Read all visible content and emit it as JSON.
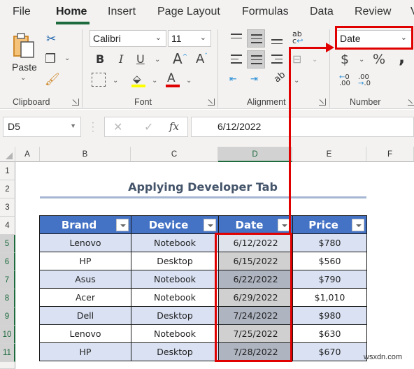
{
  "ribbon": {
    "tabs": [
      "File",
      "Home",
      "Insert",
      "Page Layout",
      "Formulas",
      "Data",
      "Review",
      "V"
    ],
    "active_tab": "Home",
    "clipboard": {
      "paste_label": "Paste",
      "group_label": "Clipboard"
    },
    "font": {
      "font_name": "Calibri",
      "font_size": "11",
      "group_label": "Font",
      "bold": "B",
      "italic": "I",
      "underline": "U",
      "grow": "A",
      "shrink": "A",
      "font_color": "A",
      "fill_color_hex": "#ffff00",
      "font_color_hex": "#e00000"
    },
    "alignment": {
      "group_label": "Alignment",
      "wrap": "ab\nc"
    },
    "number": {
      "format_value": "Date",
      "currency": "$",
      "percent": "%",
      "comma": "❜",
      "group_label": "Number"
    }
  },
  "formula_bar": {
    "name_box": "D5",
    "cancel": "✕",
    "enter": "✓",
    "fx": "fx",
    "value": "6/12/2022"
  },
  "grid": {
    "columns": [
      "A",
      "B",
      "C",
      "D",
      "E",
      "F"
    ],
    "rows": [
      "1",
      "2",
      "3",
      "4",
      "5",
      "6",
      "7",
      "8",
      "9",
      "10",
      "11"
    ],
    "selected_column": "D",
    "title": "Applying Developer Tab",
    "table": {
      "headers": [
        "Brand",
        "Device",
        "Date",
        "Price"
      ],
      "rows": [
        [
          "Lenovo",
          "Notebook",
          "6/12/2022",
          "$780"
        ],
        [
          "HP",
          "Desktop",
          "6/15/2022",
          "$560"
        ],
        [
          "Asus",
          "Notebook",
          "6/22/2022",
          "$790"
        ],
        [
          "Acer",
          "Notebook",
          "6/29/2022",
          "$1,010"
        ],
        [
          "Dell",
          "Desktop",
          "7/24/2022",
          "$980"
        ],
        [
          "Lenovo",
          "Notebook",
          "7/25/2022",
          "$630"
        ],
        [
          "HP",
          "Desktop",
          "7/28/2022",
          "$670"
        ]
      ]
    }
  },
  "annotation": {
    "color": "#e00000"
  },
  "watermark": "wsxdn.com"
}
